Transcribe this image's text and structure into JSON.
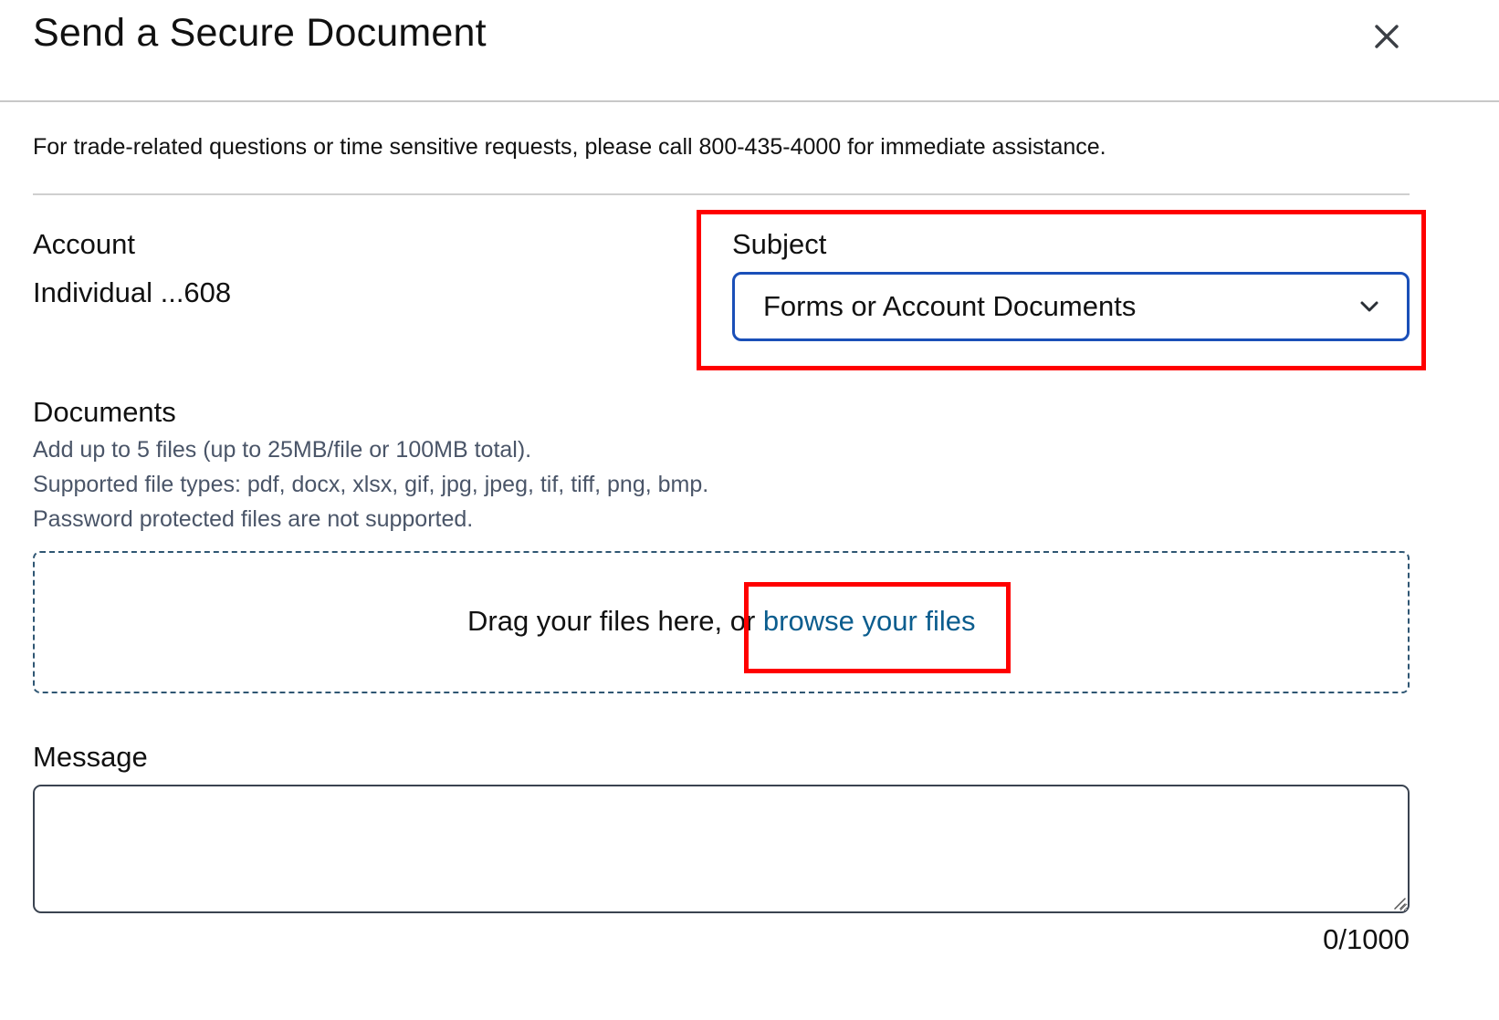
{
  "dialog": {
    "title": "Send a Secure Document",
    "close_icon": "close-icon"
  },
  "notice": {
    "text": "For trade-related questions or time sensitive requests, please call 800-435-4000 for immediate assistance."
  },
  "account": {
    "label": "Account",
    "value": "Individual ...608"
  },
  "subject": {
    "label": "Subject",
    "selected": "Forms or Account Documents",
    "dropdown_icon": "chevron-down-icon"
  },
  "documents": {
    "label": "Documents",
    "hints": [
      "Add up to 5 files (up to 25MB/file or 100MB total).",
      "Supported file types: pdf, docx, xlsx, gif, jpg, jpeg, tif, tiff, png, bmp.",
      "Password protected files are not supported."
    ],
    "dropzone_text": "Drag your files here, or ",
    "browse_link": "browse your files"
  },
  "message": {
    "label": "Message",
    "value": "",
    "char_count": "0/1000"
  },
  "colors": {
    "accent_border": "#1a4fb8",
    "link": "#0b5d8e",
    "highlight": "#ff0000",
    "hint_text": "#4a5568"
  }
}
